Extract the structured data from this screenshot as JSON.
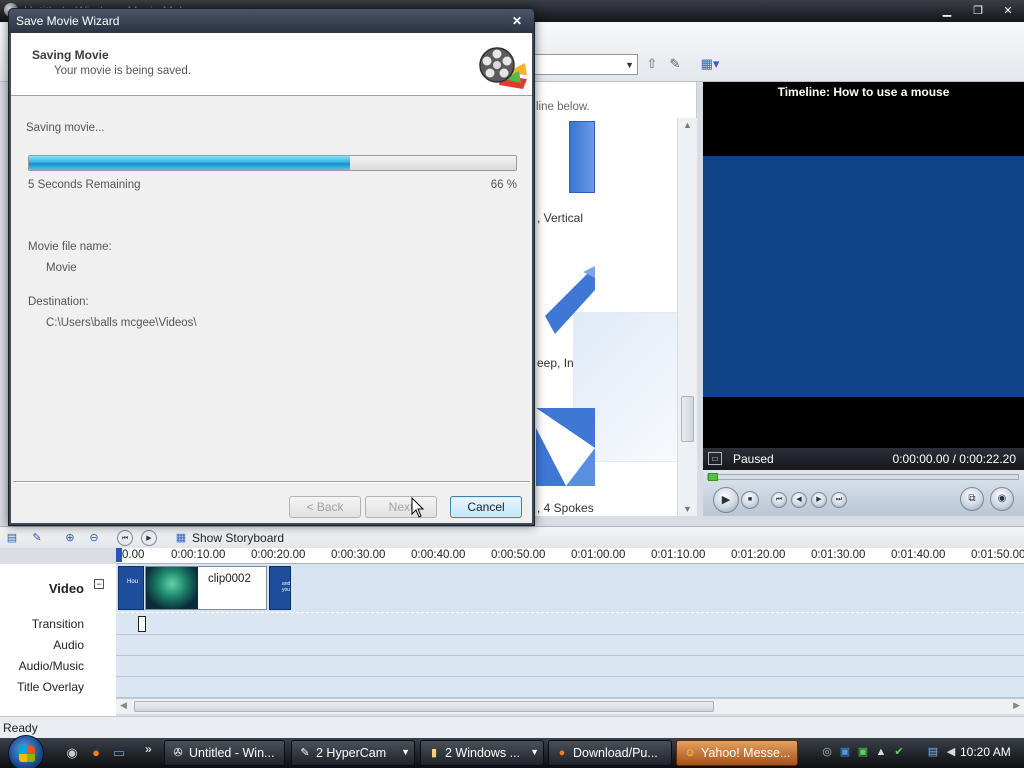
{
  "app": {
    "title": "Untitled - Windows Movie Maker"
  },
  "collections": {
    "hint": "line below.",
    "transitions": [
      {
        "label": ", Vertical"
      },
      {
        "label": "eep, In"
      },
      {
        "label": ", 4 Spokes"
      }
    ]
  },
  "monitor": {
    "title": "Timeline: How to use a mouse",
    "state": "Paused",
    "time": "0:00:00.00 / 0:00:22.20"
  },
  "timeline": {
    "show_storyboard": "Show Storyboard",
    "ticks": [
      "0.00",
      "0:00:10.00",
      "0:00:20.00",
      "0:00:30.00",
      "0:00:40.00",
      "0:00:50.00",
      "0:01:00.00",
      "0:01:10.00",
      "0:01:20.00",
      "0:01:30.00",
      "0:01:40.00",
      "0:01:50.00"
    ],
    "tracks": {
      "video": "Video",
      "transition": "Transition",
      "audio": "Audio",
      "audio_music": "Audio/Music",
      "title_overlay": "Title Overlay"
    },
    "clip_name": "clip0002",
    "clip1_text": "Hou",
    "clip3_text": "and you"
  },
  "status": "Ready",
  "wizard": {
    "title": "Save Movie Wizard",
    "header_title": "Saving Movie",
    "header_subtitle": "Your movie is being saved.",
    "progress_caption": "Saving movie...",
    "progress_fraction": 0.66,
    "time_remaining": "5 Seconds Remaining",
    "percent": "66 %",
    "filename_label": "Movie file name:",
    "filename_value": "Movie",
    "destination_label": "Destination:",
    "destination_value": "C:\\Users\\balls mcgee\\Videos\\",
    "buttons": {
      "back": "< Back",
      "next": "Next",
      "cancel": "Cancel"
    }
  },
  "taskbar": {
    "tasks": [
      {
        "label": "Untitled - Win...",
        "icon": "movie-maker-icon",
        "arrow": false
      },
      {
        "label": "2 HyperCam",
        "icon": "hypercam-icon",
        "arrow": true
      },
      {
        "label": "2 Windows ...",
        "icon": "folder-icon",
        "arrow": true
      },
      {
        "label": "Download/Pu...",
        "icon": "firefox-icon",
        "arrow": false
      },
      {
        "label": "Yahoo! Messe...",
        "icon": "yahoo-messenger-icon",
        "arrow": false
      }
    ],
    "clock": "10:20 AM"
  },
  "colors": {
    "monitor_screen": "#0f4387",
    "progress_fill": "#2fb2e3",
    "active_task": "#c97a36"
  }
}
